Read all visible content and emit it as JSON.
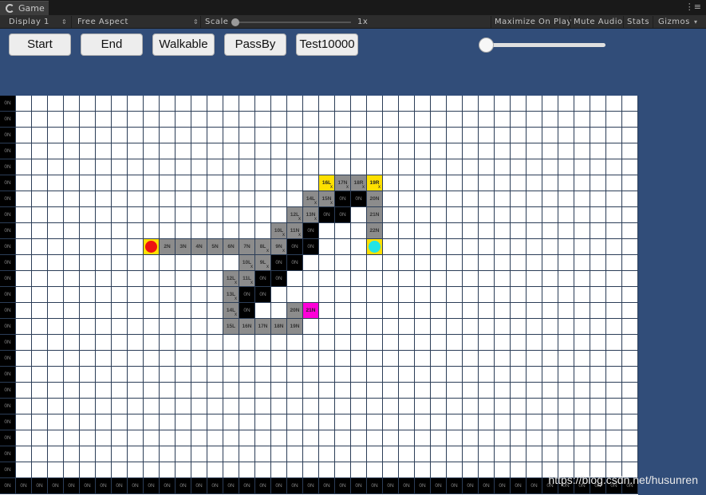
{
  "window": {
    "tab_title": "Game",
    "tab_menu": "⋮≡"
  },
  "toolbar": {
    "display": "Display 1",
    "aspect": "Free Aspect",
    "scale_label": "Scale",
    "scale_value": "1x",
    "maximize": "Maximize On Play",
    "mute": "Mute Audio",
    "stats": "Stats",
    "gizmos": "Gizmos"
  },
  "buttons": {
    "start": "Start",
    "end": "End",
    "walkable": "Walkable",
    "passby": "PassBy",
    "test": "Test10000"
  },
  "grid": {
    "columns": 40,
    "rows": 25,
    "default_label": "0N",
    "cells": [
      {
        "r": 5,
        "c": 20,
        "t": "y",
        "label": "16L",
        "x": true
      },
      {
        "r": 5,
        "c": 21,
        "t": "g",
        "label": "17N",
        "x": true
      },
      {
        "r": 5,
        "c": 22,
        "t": "g",
        "label": "18R",
        "x": true
      },
      {
        "r": 5,
        "c": 23,
        "t": "y",
        "label": "19R",
        "x": true
      },
      {
        "r": 6,
        "c": 19,
        "t": "g",
        "label": "14L",
        "x": true
      },
      {
        "r": 6,
        "c": 20,
        "t": "g",
        "label": "15N",
        "x": true
      },
      {
        "r": 6,
        "c": 21,
        "t": "b",
        "label": "0N"
      },
      {
        "r": 6,
        "c": 22,
        "t": "b",
        "label": "0N"
      },
      {
        "r": 6,
        "c": 23,
        "t": "g",
        "label": "20N"
      },
      {
        "r": 7,
        "c": 18,
        "t": "g",
        "label": "12L",
        "x": true
      },
      {
        "r": 7,
        "c": 19,
        "t": "g",
        "label": "13N",
        "x": true
      },
      {
        "r": 7,
        "c": 20,
        "t": "b",
        "label": "0N"
      },
      {
        "r": 7,
        "c": 21,
        "t": "b",
        "label": "0N"
      },
      {
        "r": 7,
        "c": 23,
        "t": "g",
        "label": "21N"
      },
      {
        "r": 8,
        "c": 17,
        "t": "g",
        "label": "10L",
        "x": true
      },
      {
        "r": 8,
        "c": 18,
        "t": "g",
        "label": "11N",
        "x": true
      },
      {
        "r": 8,
        "c": 19,
        "t": "b",
        "label": "0N"
      },
      {
        "r": 8,
        "c": 23,
        "t": "g",
        "label": "22N"
      },
      {
        "r": 9,
        "c": 9,
        "t": "start",
        "label": ""
      },
      {
        "r": 9,
        "c": 10,
        "t": "g",
        "label": "2N"
      },
      {
        "r": 9,
        "c": 11,
        "t": "g",
        "label": "3N"
      },
      {
        "r": 9,
        "c": 12,
        "t": "g",
        "label": "4N"
      },
      {
        "r": 9,
        "c": 13,
        "t": "g",
        "label": "5N"
      },
      {
        "r": 9,
        "c": 14,
        "t": "g",
        "label": "6N"
      },
      {
        "r": 9,
        "c": 15,
        "t": "g",
        "label": "7N"
      },
      {
        "r": 9,
        "c": 16,
        "t": "g",
        "label": "8L",
        "x": true
      },
      {
        "r": 9,
        "c": 17,
        "t": "g",
        "label": "9N",
        "x": true
      },
      {
        "r": 9,
        "c": 18,
        "t": "b",
        "label": "0N"
      },
      {
        "r": 9,
        "c": 19,
        "t": "b",
        "label": "0N"
      },
      {
        "r": 9,
        "c": 23,
        "t": "end",
        "label": ""
      },
      {
        "r": 10,
        "c": 15,
        "t": "g",
        "label": "10L",
        "x": true
      },
      {
        "r": 10,
        "c": 16,
        "t": "g",
        "label": "9L",
        "x": true
      },
      {
        "r": 10,
        "c": 17,
        "t": "b",
        "label": "0N"
      },
      {
        "r": 10,
        "c": 18,
        "t": "b",
        "label": "0N"
      },
      {
        "r": 11,
        "c": 14,
        "t": "g",
        "label": "12L",
        "x": true
      },
      {
        "r": 11,
        "c": 15,
        "t": "g",
        "label": "11L",
        "x": true
      },
      {
        "r": 11,
        "c": 16,
        "t": "b",
        "label": "0N"
      },
      {
        "r": 11,
        "c": 17,
        "t": "b",
        "label": "0N"
      },
      {
        "r": 12,
        "c": 14,
        "t": "g",
        "label": "13L",
        "x": true
      },
      {
        "r": 12,
        "c": 15,
        "t": "b",
        "label": "0N"
      },
      {
        "r": 12,
        "c": 16,
        "t": "b",
        "label": "0N"
      },
      {
        "r": 13,
        "c": 14,
        "t": "g",
        "label": "14L",
        "x": true
      },
      {
        "r": 13,
        "c": 15,
        "t": "b",
        "label": "0N"
      },
      {
        "r": 13,
        "c": 18,
        "t": "g",
        "label": "20N"
      },
      {
        "r": 13,
        "c": 19,
        "t": "m",
        "label": "21N"
      },
      {
        "r": 14,
        "c": 14,
        "t": "g",
        "label": "15L"
      },
      {
        "r": 14,
        "c": 15,
        "t": "g",
        "label": "16N"
      },
      {
        "r": 14,
        "c": 16,
        "t": "g",
        "label": "17N"
      },
      {
        "r": 14,
        "c": 17,
        "t": "g",
        "label": "18N"
      },
      {
        "r": 14,
        "c": 18,
        "t": "g",
        "label": "19N"
      }
    ]
  },
  "watermark": "https://blog.csdn.net/husunren"
}
